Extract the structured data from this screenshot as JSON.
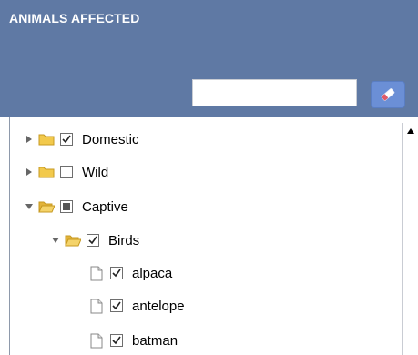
{
  "panel": {
    "title": "ANIMALS AFFECTED"
  },
  "search": {
    "value": "",
    "placeholder": ""
  },
  "tree": {
    "nodes": [
      {
        "label": "Domestic",
        "state": "checked",
        "expanded": false
      },
      {
        "label": "Wild",
        "state": "unchecked",
        "expanded": false
      },
      {
        "label": "Captive",
        "state": "partial",
        "expanded": true
      },
      {
        "label": "Birds",
        "state": "checked",
        "expanded": true
      },
      {
        "label": "alpaca",
        "state": "checked"
      },
      {
        "label": "antelope",
        "state": "checked"
      },
      {
        "label": "batman",
        "state": "checked"
      }
    ]
  },
  "scrollbar": {
    "up_icon": "triangle-up"
  },
  "colors": {
    "header_bg": "#5f79a4",
    "button_bg": "#6b8fd6",
    "folder": "#f2c94c"
  }
}
